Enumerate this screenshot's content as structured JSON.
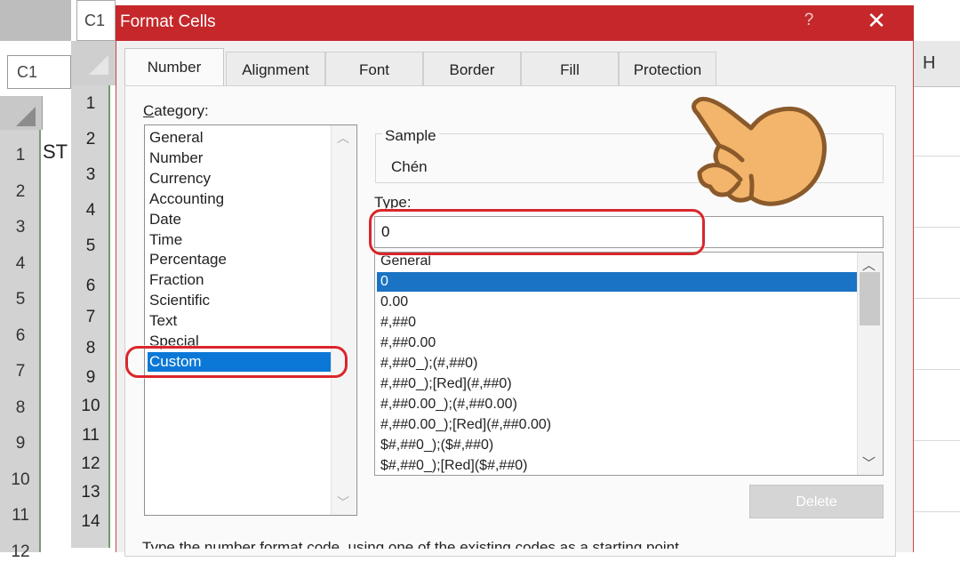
{
  "spreadsheet": {
    "name_box": "C1",
    "cell_ref_tab": "C1",
    "cell_a1_text": "ST",
    "outer_row_numbers": [
      "1",
      "2",
      "3",
      "4",
      "5",
      "6",
      "7",
      "8",
      "9",
      "10",
      "11",
      "12"
    ],
    "inner_row_numbers": [
      "1",
      "2",
      "3",
      "4",
      "5",
      "6",
      "7",
      "8",
      "9",
      "10",
      "11",
      "12",
      "13",
      "14"
    ],
    "right_column_header": "H"
  },
  "dialog": {
    "title": "Format Cells",
    "help": "?",
    "close": "✕",
    "tabs": [
      {
        "label": "Number",
        "active": true
      },
      {
        "label": "Alignment",
        "active": false
      },
      {
        "label": "Font",
        "active": false
      },
      {
        "label": "Border",
        "active": false
      },
      {
        "label": "Fill",
        "active": false
      },
      {
        "label": "Protection",
        "active": false
      }
    ],
    "category_label_first": "C",
    "category_label_rest": "ategory:",
    "categories": [
      "General",
      "Number",
      "Currency",
      "Accounting",
      "Date",
      "Time",
      "Percentage",
      "Fraction",
      "Scientific",
      "Text",
      "Special",
      "Custom"
    ],
    "selected_category": "Custom",
    "sample_label": "Sample",
    "sample_value": "Chén",
    "type_label": "Type:",
    "type_value": "0",
    "format_codes": [
      "General",
      "0",
      "0.00",
      "#,##0",
      "#,##0.00",
      "#,##0_);(#,##0)",
      "#,##0_);[Red](#,##0)",
      "#,##0.00_);(#,##0.00)",
      "#,##0.00_);[Red](#,##0.00)",
      "$#,##0_);($#,##0)",
      "$#,##0_);[Red]($#,##0)"
    ],
    "selected_format": "0",
    "delete_label": "Delete",
    "footer_text": "Type the number format code, using one of the existing codes as a starting point."
  },
  "annotations": {
    "highlight_color": "#d9262b",
    "hand_color": "#f3b56b"
  },
  "colors": {
    "titlebar": "#c5272a",
    "selection": "#0b78d7"
  }
}
